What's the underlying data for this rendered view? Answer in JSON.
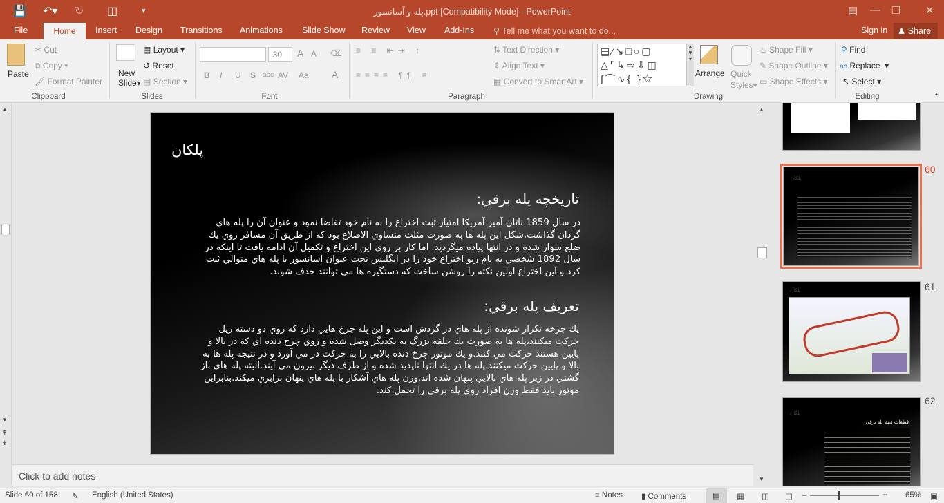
{
  "window": {
    "title": "پله و آسانسور.ppt [Compatibility Mode] - PowerPoint",
    "accent": "#b7472a"
  },
  "qat": {
    "save_icon": "save-icon",
    "undo_icon": "undo-icon",
    "redo_icon": "redo-icon",
    "present_icon": "start-from-beginning-icon",
    "customize_icon": "customize-qat-icon"
  },
  "tabs": [
    "File",
    "Home",
    "Insert",
    "Design",
    "Transitions",
    "Animations",
    "Slide Show",
    "Review",
    "View",
    "Add-Ins"
  ],
  "tell_me": "Tell me what you want to do...",
  "sign_in": "Sign in",
  "share": "Share",
  "ribbon": {
    "clipboard": {
      "label": "Clipboard",
      "paste": "Paste",
      "cut": "Cut",
      "copy": "Copy",
      "format_painter": "Format Painter"
    },
    "slides": {
      "label": "Slides",
      "new_slide_1": "New",
      "new_slide_2": "Slide",
      "layout": "Layout",
      "reset": "Reset",
      "section": "Section"
    },
    "font": {
      "label": "Font",
      "font_name": "",
      "font_size": "30",
      "bold": "B",
      "italic": "I",
      "underline": "U",
      "shadow": "S",
      "strike": "abc",
      "spacing": "AV",
      "case": "Aa",
      "color": "A",
      "grow": "A",
      "shrink": "A"
    },
    "paragraph": {
      "label": "Paragraph",
      "text_direction": "Text Direction",
      "align_text": "Align Text",
      "smartart": "Convert to SmartArt"
    },
    "drawing": {
      "label": "Drawing",
      "arrange": "Arrange",
      "quick_styles_1": "Quick",
      "quick_styles_2": "Styles",
      "shape_fill": "Shape Fill",
      "shape_outline": "Shape Outline",
      "shape_effects": "Shape Effects"
    },
    "editing": {
      "label": "Editing",
      "find": "Find",
      "replace": "Replace",
      "select": "Select"
    }
  },
  "slide": {
    "title": "پلکان",
    "h1": "تاريخچه پله برقي:",
    "p1": "در سال 1859 ناتان آميز آمريكا امتياز ثبت اختراع را به نام خود تقاضا نمود و عنوان آن را پله هاي گردان گذاشت،شكل اين پله ها به صورت مثلث متساوي الاضلاع بود كه از طريق آن مسافر روي يك ضلع سوار شده و در انتها پياده ميگرديد. اما كار بر روي اين اختراع و تكميل آن ادامه يافت تا اينكه در سال 1892 شخصي به نام رنو اختراع خود را در انگليس تحت عنوان آسانسور با پله هاي متوالي ثبت كرد و اين اختراع اولين نكته را روشن ساخت كه دستگيره ها مي توانند حذف شوند.",
    "h2": "تعريف پله برقي:",
    "p2": "يك چرخه تكرار شونده از پله هاي در گردش است و اين پله چرخ هايي دارد كه روي دو دسته ريل حركت ميكنند،پله ها به صورت يك حلقه بزرگ به يكديگر وصل شده و روي چرخ دنده اي كه در بالا و پايين هستند حركت مي كنند.و يك موتور چرخ دنده بالايي را به حركت در مي آورد و در نتيجه پله ها به بالا و پايين حركت ميكنند.پله ها در يك انتها ناپديد شده و از طرف ديگر بيرون مي آيند.البته پله هاي باز گشتي در زير پله هاي بالايي پنهان شده اند.وزن پله هاي آشكار با پله هاي پنهان برابري ميكند.بنابراين موتور بايد فقط وزن افراد روي پله برقي را تحمل كند."
  },
  "notes_placeholder": "Click to add notes",
  "thumbnails": [
    {
      "number": ""
    },
    {
      "number": "60",
      "selected": true,
      "title": "پلکان"
    },
    {
      "number": "61",
      "title": "پلکان"
    },
    {
      "number": "62",
      "title": "پلکان",
      "heading": "قطعات مهم پله برقي:"
    }
  ],
  "status": {
    "slide": "Slide 60 of 158",
    "language": "English (United States)",
    "notes": "Notes",
    "comments": "Comments",
    "zoom": "65%",
    "zoom_value": 65
  }
}
